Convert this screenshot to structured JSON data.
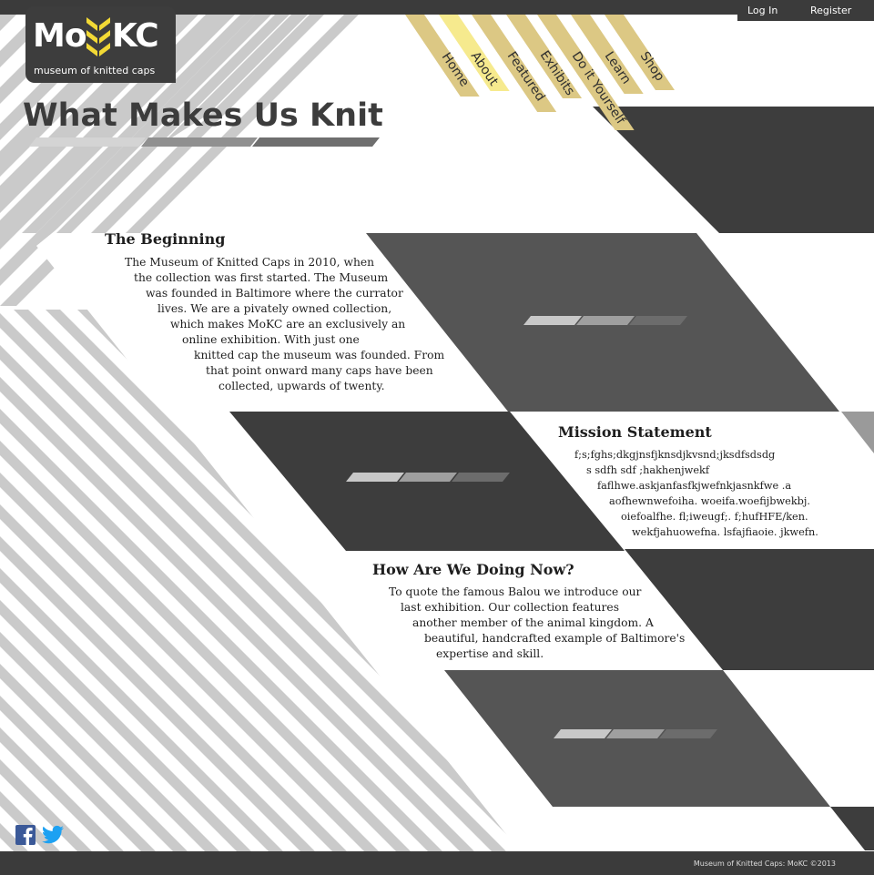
{
  "account": {
    "login": "Log In",
    "register": "Register"
  },
  "logo": {
    "left": "Mo",
    "right": "KC",
    "subtitle": "museum of knitted caps"
  },
  "page_title": "What Makes Us Knit",
  "nav": [
    "Home",
    "About",
    "Featured",
    "Exhibits",
    "Do it Yourself",
    "Learn",
    "Shop"
  ],
  "sections": {
    "beginning": {
      "title": "The Beginning",
      "lines": [
        "The Museum of Knitted Caps in 2010, when",
        "the collection was first started. The Museum",
        "was founded in Baltimore where the currator",
        "lives. We are a pivately owned collection,",
        "which makes MoKC are an exclusively an",
        "online exhibition. With just one",
        "knitted cap the museum was founded. From",
        "that point onward many caps have been",
        "collected, upwards of twenty."
      ]
    },
    "mission": {
      "title": "Mission Statement",
      "lines": [
        "f;s;fghs;dkgjnsfjknsdjkvsnd;jksdfsdsdg",
        "s sdfh sdf ;hakhenjwekf",
        "faflhwe.askjanfasfkjwefnkjasnkfwe .a",
        "aofhewnwefoiha. woeifa.woefijbwekbj.",
        "oiefoalfhe. fl;iweugf;. f;hufHFE/ken.",
        "wekfjahuowefna. lsfajfiaoie. jkwefn."
      ]
    },
    "now": {
      "title": "How Are We Doing Now?",
      "lines": [
        "To quote the famous Balou we introduce our",
        "last exhibition.  Our collection features",
        "another member of the animal kingdom. A",
        "beautiful, handcrafted example of Baltimore's",
        "expertise and skill."
      ]
    }
  },
  "footer": {
    "copyright": "Museum of Knitted Caps: MoKC ©2013"
  },
  "social": {
    "facebook": "facebook-icon",
    "twitter": "twitter-icon"
  },
  "colors": {
    "dark": "#3d3d3d",
    "mid": "#555555",
    "stripe": "#cacaca",
    "nav_gold": "#dcc884",
    "nav_yellow": "#f6ea8e",
    "facebook": "#3b5998",
    "twitter": "#1da1f2"
  }
}
